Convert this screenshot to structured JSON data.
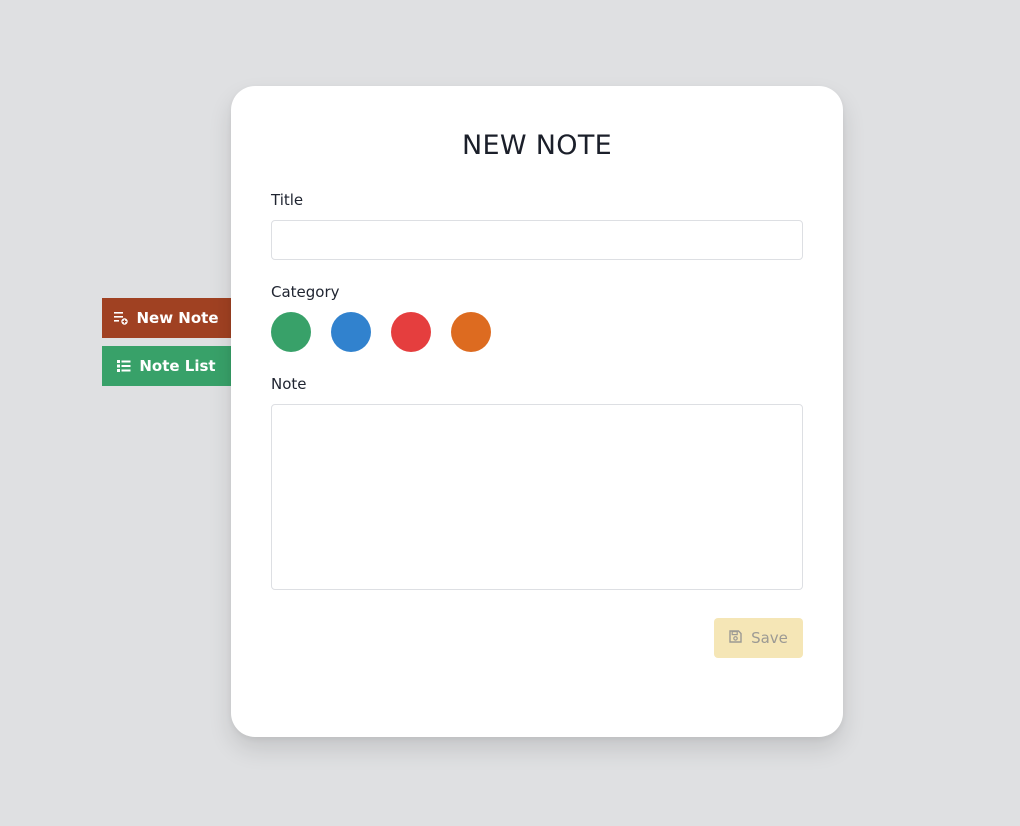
{
  "sidebar": {
    "new_note": {
      "label": "New Note",
      "icon": "playlist-add-icon",
      "color": "#a04122"
    },
    "note_list": {
      "label": "Note List",
      "icon": "list-icon",
      "color": "#38a169"
    }
  },
  "form": {
    "heading": "NEW NOTE",
    "title_label": "Title",
    "title_value": "",
    "category_label": "Category",
    "categories": [
      {
        "color": "#38a169"
      },
      {
        "color": "#3182ce"
      },
      {
        "color": "#e53e3e"
      },
      {
        "color": "#dd6b20"
      }
    ],
    "note_label": "Note",
    "note_value": "",
    "save_label": "Save",
    "save_icon": "floppy-disk-icon",
    "save_color": "#f5e6b6"
  }
}
